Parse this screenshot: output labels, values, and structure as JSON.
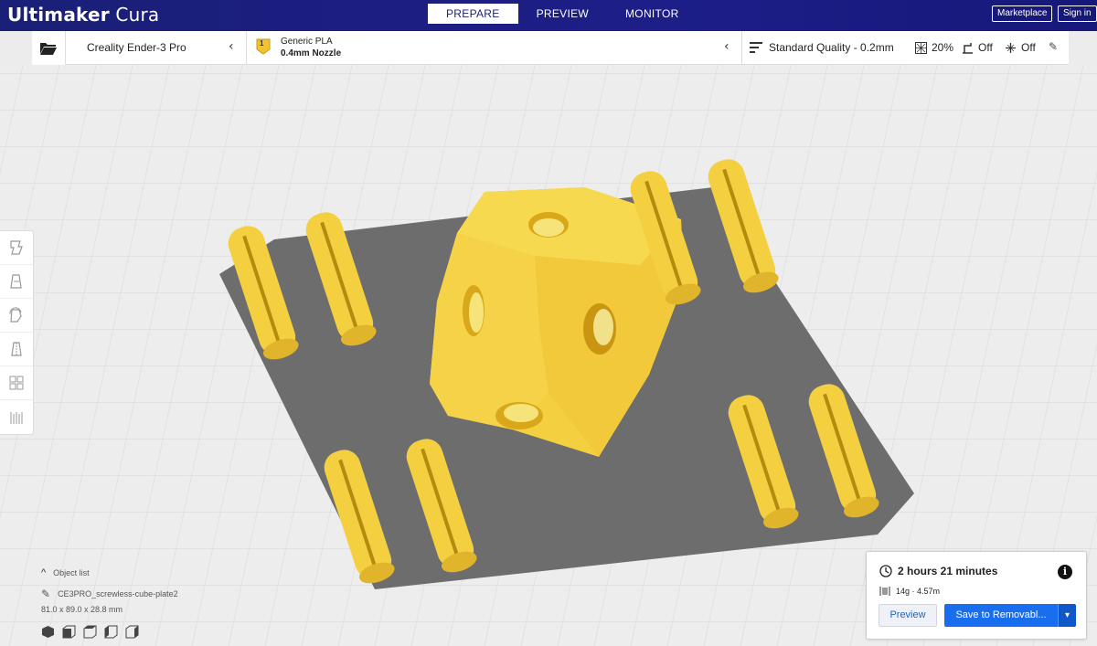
{
  "app": {
    "title_bold": "Ultimaker",
    "title_light": " Cura"
  },
  "header": {
    "tabs": [
      {
        "label": "PREPARE",
        "active": true
      },
      {
        "label": "PREVIEW",
        "active": false
      },
      {
        "label": "MONITOR",
        "active": false
      }
    ],
    "marketplace_label": "Marketplace",
    "signin_label": "Sign in"
  },
  "topbar": {
    "open_icon": "folder-icon",
    "printer_name": "Creality Ender-3 Pro",
    "material_badge": "1",
    "material_name": "Generic PLA",
    "nozzle": "0.4mm Nozzle",
    "quality": "Standard Quality - 0.2mm",
    "infill": "20%",
    "support": "Off",
    "adhesion": "Off"
  },
  "toolbar": {
    "tools": [
      "move-tool-icon",
      "scale-tool-icon",
      "rotate-tool-icon",
      "mirror-tool-icon",
      "per-model-settings-icon",
      "support-blocker-icon"
    ]
  },
  "object": {
    "list_label": "Object list",
    "name": "CE3PRO_screwless-cube-plate2",
    "dimensions": "81.0 x 89.0 x 28.8 mm"
  },
  "print": {
    "time": "2 hours 21 minutes",
    "material_usage": "14g · 4.57m",
    "preview_label": "Preview",
    "save_label": "Save to Removabl..."
  },
  "colors": {
    "header": "#1d1e88",
    "model": "#f5d34a",
    "plate": "#6c6c6c",
    "accent": "#196ef0"
  }
}
